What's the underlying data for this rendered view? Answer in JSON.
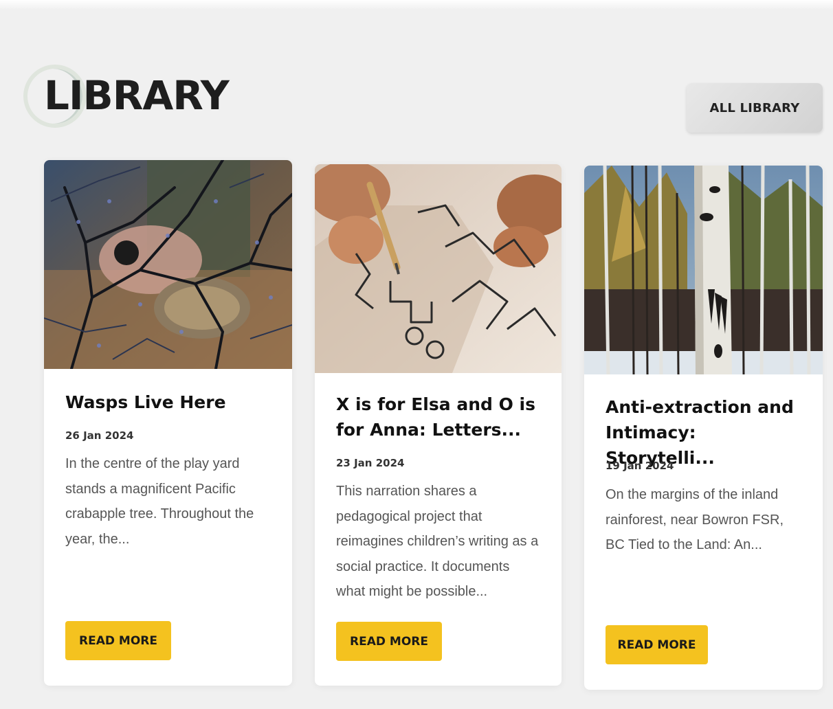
{
  "header": {
    "title": "LIBRARY",
    "all_button_label": "ALL LIBRARY"
  },
  "cards": [
    {
      "title": "Wasps Live Here",
      "date": "26 Jan 2024",
      "excerpt": "In the centre of the play yard stands a magnificent Pacific crabapple tree. Throughout the year, the...",
      "button_label": "READ MORE"
    },
    {
      "title": "X is for Elsa and O is for Anna: Letters...",
      "date": "23 Jan 2024",
      "excerpt": "This narration shares a pedagogical project that reimagines children’s writing as a social practice. It documents what might be possible...",
      "button_label": "READ MORE"
    },
    {
      "title": "Anti-extraction and Intimacy: Storytelli...",
      "date": "19 Jan 2024",
      "excerpt": "On the margins of the inland rainforest, near Bowron FSR, BC Tied to the Land: An...",
      "button_label": "READ MORE"
    }
  ],
  "colors": {
    "page_background": "#f0f0f0",
    "card_background": "#ffffff",
    "button_accent": "#f4c21f",
    "title_text": "#1e1e1e"
  }
}
